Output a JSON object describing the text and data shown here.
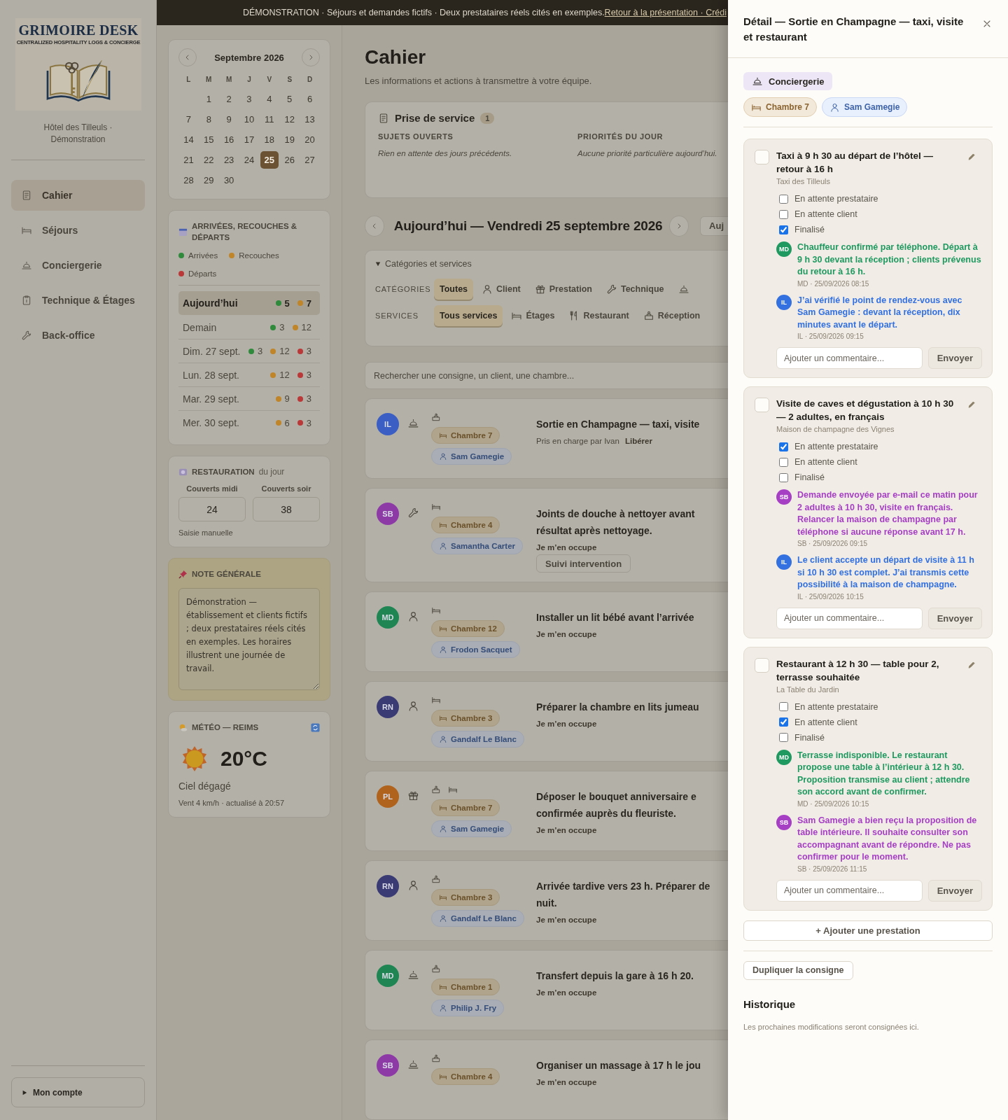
{
  "banner": {
    "text": "DÉMONSTRATION · Séjours et demandes fictifs · Deux prestataires réels cités en exemples.",
    "link": "Retour à la présentation · Crédi"
  },
  "sidebar": {
    "logo": {
      "title": "GRIMOIRE DESK",
      "tagline": "CENTRALIZED HOSPITALITY LOGS & CONCIERGE"
    },
    "hotel": "Hôtel des Tilleuls · Démonstration",
    "items": [
      {
        "label": "Cahier",
        "selected": true
      },
      {
        "label": "Séjours",
        "selected": false
      },
      {
        "label": "Conciergerie",
        "selected": false
      },
      {
        "label": "Technique & Étages",
        "selected": false
      },
      {
        "label": "Back-office",
        "selected": false
      }
    ],
    "account": "Mon compte"
  },
  "calendar": {
    "month": "Septembre 2026",
    "weekdays": [
      "L",
      "M",
      "M",
      "J",
      "V",
      "S",
      "D"
    ],
    "weeks": [
      [
        {
          "day": "1",
          "selected": false
        },
        {
          "day": "2",
          "selected": false
        },
        {
          "day": "3",
          "selected": false
        },
        {
          "day": "4",
          "selected": false
        },
        {
          "day": "5",
          "selected": false
        },
        {
          "day": "6",
          "selected": false
        }
      ],
      [
        {
          "day": "7",
          "selected": false
        },
        {
          "day": "8",
          "selected": false
        },
        {
          "day": "9",
          "selected": false
        },
        {
          "day": "10",
          "selected": false
        },
        {
          "day": "11",
          "selected": false
        },
        {
          "day": "12",
          "selected": false
        },
        {
          "day": "13",
          "selected": false
        }
      ],
      [
        {
          "day": "14",
          "selected": false
        },
        {
          "day": "15",
          "selected": false
        },
        {
          "day": "16",
          "selected": false
        },
        {
          "day": "17",
          "selected": false
        },
        {
          "day": "18",
          "selected": false
        },
        {
          "day": "19",
          "selected": false
        },
        {
          "day": "20",
          "selected": false
        }
      ],
      [
        {
          "day": "21",
          "selected": false
        },
        {
          "day": "22",
          "selected": false
        },
        {
          "day": "23",
          "selected": false
        },
        {
          "day": "24",
          "selected": false
        },
        {
          "day": "25",
          "selected": true
        },
        {
          "day": "26",
          "selected": false
        },
        {
          "day": "27",
          "selected": false
        }
      ],
      [
        {
          "day": "28",
          "selected": false
        },
        {
          "day": "29",
          "selected": false
        },
        {
          "day": "30",
          "selected": false
        }
      ]
    ]
  },
  "movements": {
    "title": "ARRIVÉES, RECOUCHES & DÉPARTS",
    "legend": [
      {
        "label": "Arrivées",
        "color": "#2f8a3c"
      },
      {
        "label": "Recouches",
        "color": "#c08429"
      },
      {
        "label": "Départs",
        "color": "#bb3838"
      }
    ],
    "days": [
      {
        "label": "Aujourd’hui",
        "selected": true,
        "counts": [
          {
            "value": "5",
            "color": "#2f8a3c"
          },
          {
            "value": "7",
            "color": "#c08429"
          }
        ]
      },
      {
        "label": "Demain",
        "selected": false,
        "counts": [
          {
            "value": "3",
            "color": "#2f8a3c"
          },
          {
            "value": "12",
            "color": "#c08429"
          }
        ]
      },
      {
        "label": "Dim. 27 sept.",
        "selected": false,
        "counts": [
          {
            "value": "3",
            "color": "#2f8a3c"
          },
          {
            "value": "12",
            "color": "#c08429"
          },
          {
            "value": "3",
            "color": "#bb3838"
          }
        ]
      },
      {
        "label": "Lun. 28 sept.",
        "selected": false,
        "counts": [
          {
            "value": "12",
            "color": "#c08429"
          },
          {
            "value": "3",
            "color": "#bb3838"
          }
        ]
      },
      {
        "label": "Mar. 29 sept.",
        "selected": false,
        "counts": [
          {
            "value": "9",
            "color": "#c08429"
          },
          {
            "value": "3",
            "color": "#bb3838"
          }
        ]
      },
      {
        "label": "Mer. 30 sept.",
        "selected": false,
        "counts": [
          {
            "value": "6",
            "color": "#c08429"
          },
          {
            "value": "3",
            "color": "#bb3838"
          }
        ]
      }
    ]
  },
  "restaurant": {
    "title": "RESTAURATION",
    "suffix": "du jour",
    "fields": [
      {
        "label": "Couverts midi",
        "value": "24"
      },
      {
        "label": "Couverts soir",
        "value": "38"
      }
    ],
    "note": "Saisie manuelle"
  },
  "general_note": {
    "title": "NOTE GÉNÉRALE",
    "text": "Démonstration — établissement et clients fictifs ; deux prestataires réels cités en exemples. Les horaires illustrent une journée de travail."
  },
  "weather": {
    "title": "MÉTÉO — REIMS",
    "temperature": "20°C",
    "condition": "Ciel dégagé",
    "details": "Vent 4 km/h · actualisé à 20:57"
  },
  "main": {
    "title": "Cahier",
    "subtitle": "Les informations et actions à transmettre à votre équipe.",
    "shift": {
      "title": "Prise de service",
      "count": "1",
      "columns": [
        {
          "heading": "SUJETS OUVERTS",
          "text": "Rien en attente des jours précédents."
        },
        {
          "heading": "PRIORITÉS DU JOUR",
          "text": "Aucune priorité particulière aujourd’hui."
        }
      ]
    },
    "date": {
      "title": "Aujourd’hui — Vendredi 25 septembre 2026",
      "today_button": "Auj"
    },
    "filters": {
      "summary": "Catégories et services",
      "expanded": true,
      "rows": [
        {
          "label": "CATÉGORIES",
          "chips": [
            {
              "label": "Toutes",
              "selected": true
            },
            {
              "label": "Client",
              "selected": false
            },
            {
              "label": "Prestation",
              "selected": false
            },
            {
              "label": "Technique",
              "selected": false
            },
            {
              "selected": false
            }
          ]
        },
        {
          "label": "SERVICES",
          "chips": [
            {
              "label": "Tous services",
              "selected": true
            },
            {
              "label": "Étages",
              "selected": false
            },
            {
              "label": "Restaurant",
              "selected": false
            },
            {
              "label": "Réception",
              "selected": false
            }
          ]
        }
      ]
    },
    "search": {
      "placeholder": "Rechercher une consigne, un client, une chambre..."
    },
    "tasks": [
      {
        "initials": "IL",
        "color": "#3a5ec4",
        "kind": "concierge",
        "room": "Chambre 7",
        "client": "Sam Gamegie",
        "title": "Sortie en Champagne — taxi, visite",
        "status": "Pris en charge par Ivan",
        "action": "Libérer"
      },
      {
        "initials": "SB",
        "color": "#8d3aa6",
        "kind": "technique",
        "room": "Chambre 4",
        "client": "Samantha Carter",
        "title": "Joints de douche à nettoyer avant résultat après nettoyage.",
        "action": "Je m’en occupe",
        "button": "Suivi intervention"
      },
      {
        "initials": "MD",
        "color": "#1f8553",
        "kind": "client",
        "room": "Chambre 12",
        "client": "Frodon Sacquet",
        "title": "Installer un lit bébé avant l’arrivée",
        "action": "Je m’en occupe"
      },
      {
        "initials": "RN",
        "color": "#3a3a74",
        "kind": "client",
        "room": "Chambre 3",
        "client": "Gandalf Le Blanc",
        "title": "Préparer la chambre en lits jumeau",
        "action": "Je m’en occupe"
      },
      {
        "initials": "PL",
        "color": "#b0631c",
        "kind": "prestation",
        "room": "Chambre 7",
        "client": "Sam Gamegie",
        "title": "Déposer le bouquet anniversaire e confirmée auprès du fleuriste.",
        "action": "Je m’en occupe"
      },
      {
        "initials": "RN",
        "color": "#3a3a74",
        "kind": "client",
        "room": "Chambre 3",
        "client": "Gandalf Le Blanc",
        "title": "Arrivée tardive vers 23 h. Préparer de nuit.",
        "action": "Je m’en occupe"
      },
      {
        "initials": "MD",
        "color": "#1f8553",
        "kind": "concierge",
        "room": "Chambre 1",
        "client": "Philip J. Fry",
        "title": "Transfert depuis la gare à 16 h 20.",
        "action": "Je m’en occupe"
      },
      {
        "initials": "SB",
        "color": "#8d3aa6",
        "kind": "concierge",
        "room": "Chambre 4",
        "title": "Organiser un massage à 17 h le jou",
        "action": "Je m’en occupe"
      }
    ]
  },
  "drawer": {
    "title": "Détail — Sortie en Champagne — taxi, visite et restaurant",
    "category": "Conciergerie",
    "room": "Chambre 7",
    "client": "Sam Gamegie",
    "services": [
      {
        "done": false,
        "title": "Taxi à 9 h 30 au départ de l’hôtel — retour à 16 h",
        "provider": "Taxi des Tilleuls",
        "statuses": [
          {
            "label": "En attente prestataire",
            "checked": false
          },
          {
            "label": "En attente client",
            "checked": false
          },
          {
            "label": "Finalisé",
            "checked": true
          }
        ],
        "comments": [
          {
            "initials": "MD",
            "color": "#1f9960",
            "text": "Chauffeur confirmé par téléphone. Départ à 9 h 30 devant la réception ; clients prévenus du retour à 16 h.",
            "meta": "MD · 25/09/2026 08:15"
          },
          {
            "initials": "IL",
            "color": "#3370e0",
            "text": "J’ai vérifié le point de rendez-vous avec Sam Gamegie : devant la réception, dix minutes avant le départ.",
            "meta": "IL · 25/09/2026 09:15"
          }
        ],
        "placeholder": "Ajouter un commentaire...",
        "send": "Envoyer"
      },
      {
        "done": false,
        "title": "Visite de caves et dégustation à 10 h 30 — 2 adultes, en français",
        "provider": "Maison de champagne des Vignes",
        "statuses": [
          {
            "label": "En attente prestataire",
            "checked": true
          },
          {
            "label": "En attente client",
            "checked": false
          },
          {
            "label": "Finalisé",
            "checked": false
          }
        ],
        "comments": [
          {
            "initials": "SB",
            "color": "#a63fc4",
            "text": "Demande envoyée par e-mail ce matin pour 2 adultes à 10 h 30, visite en français. Relancer la maison de champagne par téléphone si aucune réponse avant 17 h.",
            "meta": "SB · 25/09/2026 09:15"
          },
          {
            "initials": "IL",
            "color": "#3370e0",
            "text": "Le client accepte un départ de visite à 11 h si 10 h 30 est complet. J’ai transmis cette possibilité à la maison de champagne.",
            "meta": "IL · 25/09/2026 10:15"
          }
        ],
        "placeholder": "Ajouter un commentaire...",
        "send": "Envoyer"
      },
      {
        "done": false,
        "title": "Restaurant à 12 h 30 — table pour 2, terrasse souhaitée",
        "provider": "La Table du Jardin",
        "statuses": [
          {
            "label": "En attente prestataire",
            "checked": false
          },
          {
            "label": "En attente client",
            "checked": true
          },
          {
            "label": "Finalisé",
            "checked": false
          }
        ],
        "comments": [
          {
            "initials": "MD",
            "color": "#1f9960",
            "text": "Terrasse indisponible. Le restaurant propose une table à l’intérieur à 12 h 30. Proposition transmise au client ; attendre son accord avant de confirmer.",
            "meta": "MD · 25/09/2026 10:15"
          },
          {
            "initials": "SB",
            "color": "#a63fc4",
            "text": "Sam Gamegie a bien reçu la proposition de table intérieure. Il souhaite consulter son accompagnant avant de répondre. Ne pas confirmer pour le moment.",
            "meta": "SB · 25/09/2026 11:15"
          }
        ],
        "placeholder": "Ajouter un commentaire...",
        "send": "Envoyer"
      }
    ],
    "add_button": "+ Ajouter une prestation",
    "duplicate_button": "Dupliquer la consigne",
    "history": {
      "title": "Historique",
      "text": "Les prochaines modifications seront consignées ici."
    }
  }
}
